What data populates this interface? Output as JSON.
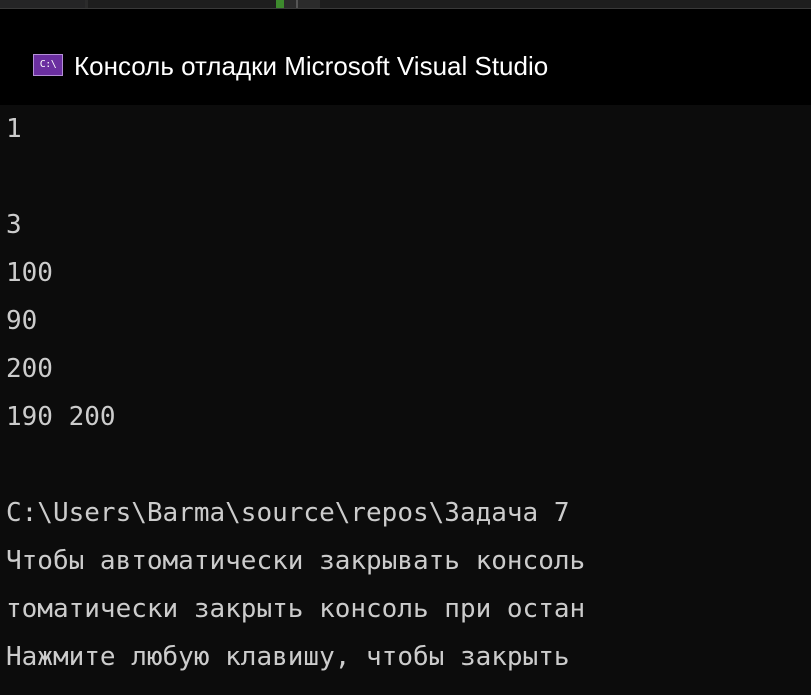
{
  "window": {
    "title": "Консоль отладки Microsoft Visual Studio",
    "icon": "console-app-icon",
    "icon_text": "C:\\",
    "icon_color": "#6b2fa0"
  },
  "console": {
    "lines": [
      "1",
      "",
      "3",
      "100",
      "90",
      "200",
      "190 200",
      "",
      "C:\\Users\\Barma\\source\\repos\\Задача 7",
      "Чтобы автоматически закрывать консоль",
      "томатически закрыть консоль при остан",
      "Нажмите любую клавишу, чтобы закрыть"
    ],
    "text_color": "#cccccc",
    "background": "#0c0c0c"
  }
}
